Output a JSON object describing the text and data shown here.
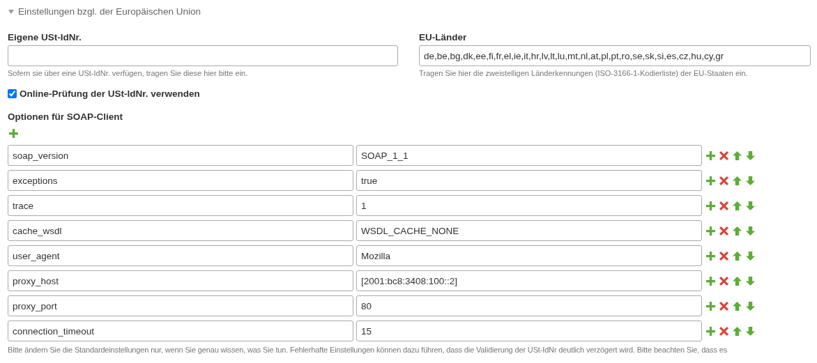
{
  "section": {
    "title": "Einstellungen bzgl. der Europäischen Union",
    "expanded": true
  },
  "vat_id": {
    "label": "Eigene USt-IdNr.",
    "help": "Sofern sie über eine USt-IdNr. verfügen, tragen Sie diese hier bitte ein."
  },
  "eu_countries": {
    "label": "EU-Länder",
    "value": "de,be,bg,dk,ee,fi,fr,el,ie,it,hr,lv,lt,lu,mt,nl,at,pl,pt,ro,se,sk,si,es,cz,hu,cy,gr",
    "help": "Tragen Sie hier die zweistelligen Länderkennungen (ISO-3166-1-Kodierliste) der EU-Staaten ein."
  },
  "online_check": {
    "label": "Online-Prüfung der USt-IdNr. verwenden",
    "checked": true
  },
  "soap_options": {
    "label": "Optionen für SOAP-Client",
    "rows": [
      {
        "key": "soap_version",
        "value": "SOAP_1_1"
      },
      {
        "key": "exceptions",
        "value": "true"
      },
      {
        "key": "trace",
        "value": "1"
      },
      {
        "key": "cache_wsdl",
        "value": "WSDL_CACHE_NONE"
      },
      {
        "key": "user_agent",
        "value": "Mozilla"
      },
      {
        "key": "proxy_host",
        "value": "[2001:bc8:3408:100::2]"
      },
      {
        "key": "proxy_port",
        "value": "80"
      },
      {
        "key": "connection_timeout",
        "value": "15"
      }
    ],
    "help": "Bitte ändern Sie die Standardeinstellungen nur, wenn Sie genau wissen, was Sie tun. Fehlerhafte Einstellungen können dazu führen, dass die Validierung der USt-IdNr deutlich verzögert wird. Bitte beachten Sie, dass es"
  }
}
